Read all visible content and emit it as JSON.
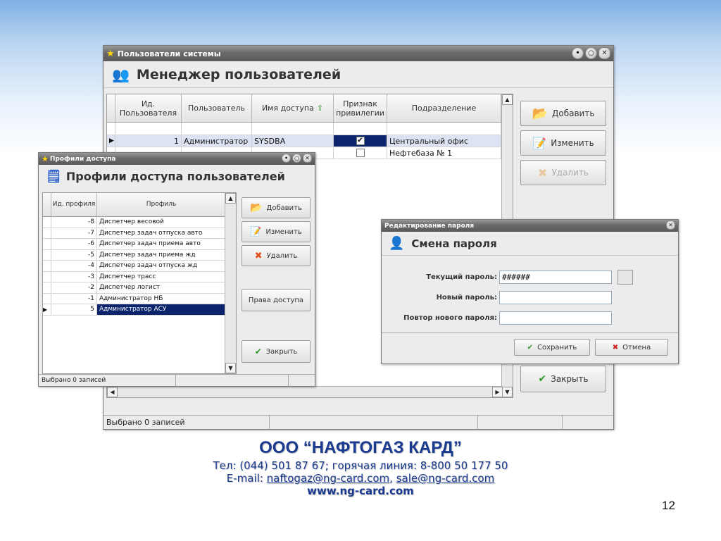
{
  "main": {
    "title": "Пользователи системы",
    "header": "Менеджер пользователей",
    "columns": [
      "Ид. Пользователя",
      "Пользователь",
      "Имя доступа",
      "Признак привилегии",
      "Подразделение"
    ],
    "rows": [
      {
        "id": "1",
        "user": "Администратор",
        "login": "SYSDBA",
        "priv": "✔",
        "dept": "Центральный офис"
      },
      {
        "id": "",
        "user": "",
        "login": "",
        "priv": "",
        "dept": "Нефтебаза № 1"
      }
    ],
    "buttons": {
      "add": "Добавить",
      "edit": "Изменить",
      "del": "Удалить",
      "close": "Закрыть"
    },
    "status": "Выбрано 0 записей"
  },
  "profiles": {
    "title": "Профили доступа",
    "header": "Профили доступа пользователей",
    "columns": [
      "Ид. профиля",
      "Профиль"
    ],
    "rows": [
      {
        "id": "-8",
        "name": "Диспетчер весовой"
      },
      {
        "id": "-7",
        "name": "Диспетчер задач отпуска авто"
      },
      {
        "id": "-6",
        "name": "Диспетчер задач приема авто"
      },
      {
        "id": "-5",
        "name": "Диспетчер задач приема жд"
      },
      {
        "id": "-4",
        "name": "Диспетчер задач отпуска жд"
      },
      {
        "id": "-3",
        "name": "Диспетчер трасс"
      },
      {
        "id": "-2",
        "name": "Диспетчер логист"
      },
      {
        "id": "-1",
        "name": "Администратор НБ"
      },
      {
        "id": "5",
        "name": "Администратор АСУ"
      }
    ],
    "buttons": {
      "add": "Добавить",
      "edit": "Изменить",
      "del": "Удалить",
      "rights": "Права доступа",
      "close": "Закрыть"
    },
    "status": "Выбрано 0 записей"
  },
  "password": {
    "title": "Редактирование пароля",
    "header": "Смена пароля",
    "current_label": "Текущий пароль:",
    "current_value": "######",
    "new_label": "Новый пароль:",
    "repeat_label": "Повтор нового пароля:",
    "save": "Сохранить",
    "cancel": "Отмена"
  },
  "footer": {
    "company": "ООО “НАФТОГАЗ КАРД”",
    "phone": "Тел: (044) 501 87 67; горячая линия: 8-800 50 177 50",
    "email_prefix": "E-mail: ",
    "email1": "naftogaz@ng-card.com",
    "sep": ", ",
    "email2": "sale@ng-card.com",
    "web": "www.ng-card.com"
  },
  "page_number": "12"
}
